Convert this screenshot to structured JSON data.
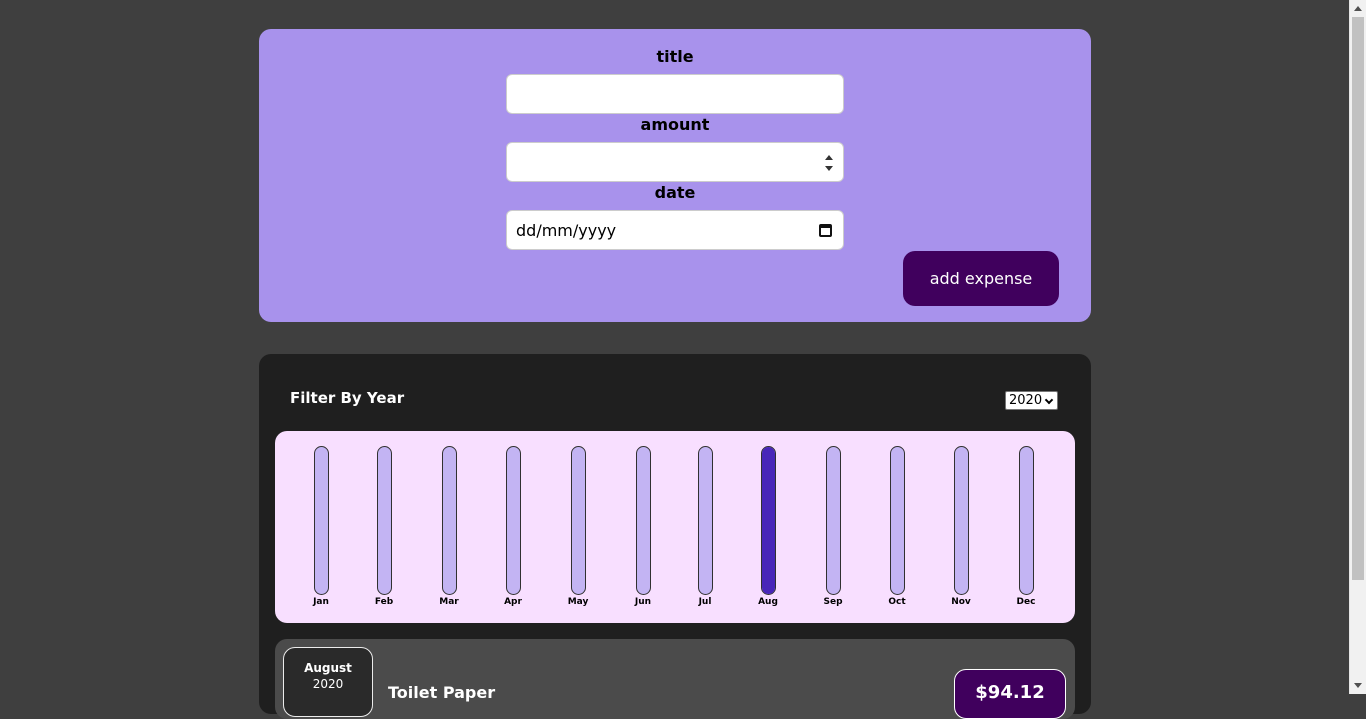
{
  "form": {
    "title_label": "title",
    "amount_label": "amount",
    "date_label": "date",
    "title_value": "",
    "amount_value": "",
    "date_placeholder": "dd/mm/yyyy",
    "submit_label": "add expense"
  },
  "filter": {
    "label": "Filter By Year",
    "selected_year": "2020"
  },
  "chart_data": {
    "type": "bar",
    "categories": [
      "Jan",
      "Feb",
      "Mar",
      "Apr",
      "May",
      "Jun",
      "Jul",
      "Aug",
      "Sep",
      "Oct",
      "Nov",
      "Dec"
    ],
    "values": [
      0,
      0,
      0,
      0,
      0,
      0,
      0,
      94.12,
      0,
      0,
      0,
      0
    ],
    "max": 94.12
  },
  "expense": {
    "month": "August",
    "year": "2020",
    "title": "Toilet Paper",
    "price": "$94.12"
  },
  "colors": {
    "form_bg": "#a892ec",
    "accent": "#40005d",
    "bar_fill": "#4826b9",
    "bar_track": "#c3b4f3",
    "chart_bg": "#f8dfff"
  }
}
